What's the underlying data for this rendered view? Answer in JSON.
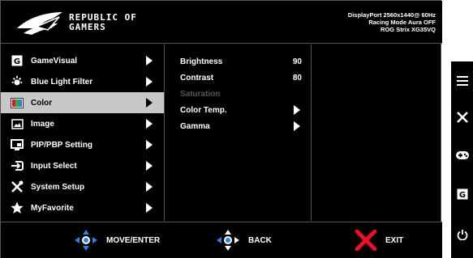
{
  "header": {
    "brand_line1": "REPUBLIC OF",
    "brand_line2": "GAMERS",
    "info_line1": "DisplayPort 2560x1440@ 60Hz",
    "info_line2": "Racing Mode Aura OFF",
    "info_line3": "ROG Strix XG35VQ"
  },
  "main_menu": [
    {
      "label": "GameVisual",
      "icon": "gamevisual-icon",
      "selected": false
    },
    {
      "label": "Blue Light Filter",
      "icon": "blue-light-icon",
      "selected": false
    },
    {
      "label": "Color",
      "icon": "color-icon",
      "selected": true
    },
    {
      "label": "Image",
      "icon": "image-icon",
      "selected": false
    },
    {
      "label": "PIP/PBP Setting",
      "icon": "pip-icon",
      "selected": false
    },
    {
      "label": "Input Select",
      "icon": "input-icon",
      "selected": false
    },
    {
      "label": "System Setup",
      "icon": "tools-icon",
      "selected": false
    },
    {
      "label": "MyFavorite",
      "icon": "star-icon",
      "selected": false
    }
  ],
  "sub_menu": [
    {
      "label": "Brightness",
      "value": "90",
      "enabled": true
    },
    {
      "label": "Contrast",
      "value": "80",
      "enabled": true
    },
    {
      "label": "Saturation",
      "value": "",
      "enabled": false
    },
    {
      "label": "Color Temp.",
      "value": "",
      "enabled": true,
      "has_arrow": true
    },
    {
      "label": "Gamma",
      "value": "",
      "enabled": true,
      "has_arrow": true
    }
  ],
  "footer": {
    "move_label": "MOVE/ENTER",
    "back_label": "BACK",
    "exit_label": "EXIT"
  },
  "side_buttons": [
    "menu-icon",
    "close-icon",
    "gamepad-icon",
    "gamevisual-icon",
    "power-icon"
  ],
  "colors": {
    "selected_bg": "#c8c8c8",
    "nav_blue": "#2f7fe0",
    "exit_red": "#e8112d",
    "disabled_text": "#555555"
  }
}
